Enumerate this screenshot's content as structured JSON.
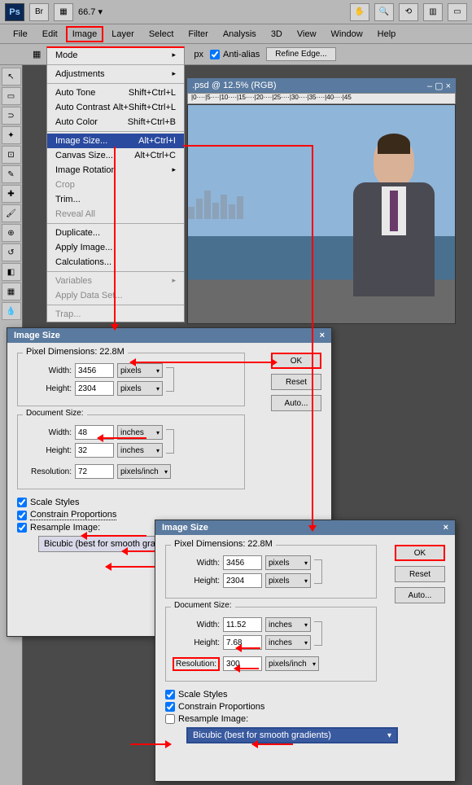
{
  "app": {
    "zoom": "66.7",
    "ps": "Ps",
    "br": "Br"
  },
  "menubar": [
    "File",
    "Edit",
    "Image",
    "Layer",
    "Select",
    "Filter",
    "Analysis",
    "3D",
    "View",
    "Window",
    "Help"
  ],
  "optbar": {
    "px": "px",
    "antialias": "Anti-alias",
    "refine": "Refine Edge..."
  },
  "doc": {
    "title": ".psd @ 12.5% (RGB)"
  },
  "image_menu": {
    "mode": "Mode",
    "adjustments": "Adjustments",
    "auto_tone": "Auto Tone",
    "auto_tone_sc": "Shift+Ctrl+L",
    "auto_contrast": "Auto Contrast",
    "auto_contrast_sc": "Alt+Shift+Ctrl+L",
    "auto_color": "Auto Color",
    "auto_color_sc": "Shift+Ctrl+B",
    "image_size": "Image Size...",
    "image_size_sc": "Alt+Ctrl+I",
    "canvas_size": "Canvas Size...",
    "canvas_size_sc": "Alt+Ctrl+C",
    "image_rotation": "Image Rotation",
    "crop": "Crop",
    "trim": "Trim...",
    "reveal_all": "Reveal All",
    "duplicate": "Duplicate...",
    "apply_image": "Apply Image...",
    "calculations": "Calculations...",
    "variables": "Variables",
    "apply_data_set": "Apply Data Set...",
    "trap": "Trap..."
  },
  "dlg1": {
    "title": "Image Size",
    "pixel_dim": "Pixel Dimensions:",
    "pixel_total": "22.8M",
    "width_l": "Width:",
    "width_v": "3456",
    "width_u": "pixels",
    "height_l": "Height:",
    "height_v": "2304",
    "height_u": "pixels",
    "doc_size": "Document Size:",
    "dw_l": "Width:",
    "dw_v": "48",
    "dw_u": "inches",
    "dh_l": "Height:",
    "dh_v": "32",
    "dh_u": "inches",
    "res_l": "Resolution:",
    "res_v": "72",
    "res_u": "pixels/inch",
    "scale": "Scale Styles",
    "constrain": "Constrain Proportions",
    "resample": "Resample Image:",
    "bicubic": "Bicubic (best for smooth gradients)",
    "ok": "OK",
    "cancel": "Reset",
    "auto": "Auto..."
  },
  "dlg2": {
    "title": "Image Size",
    "pixel_dim": "Pixel Dimensions:",
    "pixel_total": "22.8M",
    "width_l": "Width:",
    "width_v": "3456",
    "width_u": "pixels",
    "height_l": "Height:",
    "height_v": "2304",
    "height_u": "pixels",
    "doc_size": "Document Size:",
    "dw_l": "Width:",
    "dw_v": "11.52",
    "dw_u": "inches",
    "dh_l": "Height:",
    "dh_v": "7.68",
    "dh_u": "inches",
    "res_l": "Resolution:",
    "res_v": "300",
    "res_u": "pixels/inch",
    "scale": "Scale Styles",
    "constrain": "Constrain Proportions",
    "resample": "Resample Image:",
    "bicubic": "Bicubic (best for smooth gradients)",
    "ok": "OK",
    "cancel": "Reset",
    "auto": "Auto..."
  }
}
